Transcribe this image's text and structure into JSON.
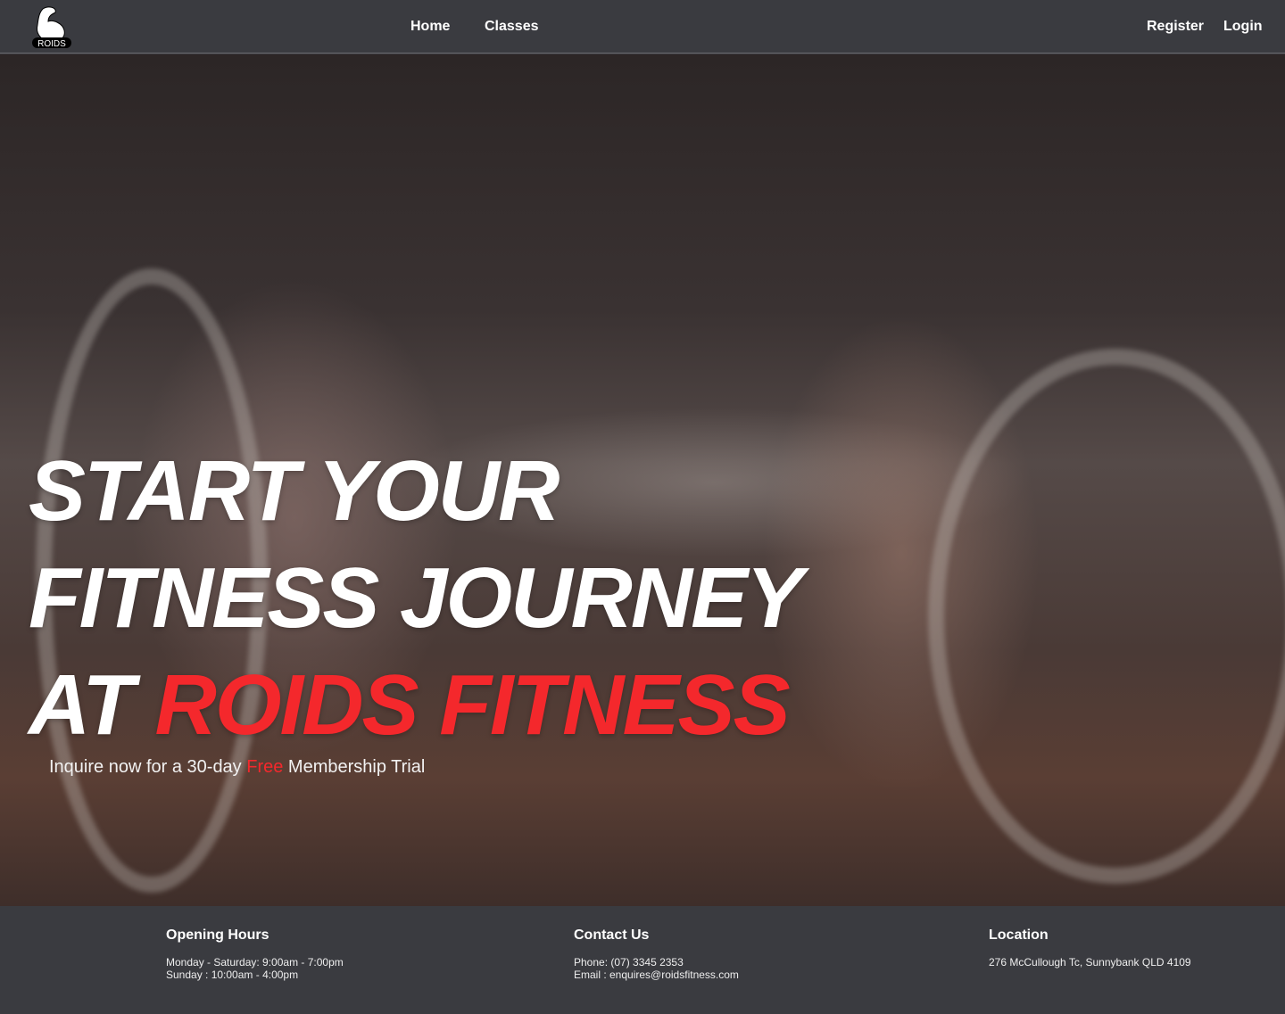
{
  "nav": {
    "logo_text": "ROIDS",
    "links": [
      {
        "label": "Home"
      },
      {
        "label": "Classes"
      }
    ],
    "auth": [
      {
        "label": "Register"
      },
      {
        "label": "Login"
      }
    ]
  },
  "hero": {
    "line1": "START YOUR",
    "line2": "FITNESS JOURNEY",
    "line3_prefix": "AT ",
    "line3_highlight": "ROIDS FITNESS",
    "sub_prefix": "Inquire now for a 30-day ",
    "sub_highlight": "Free",
    "sub_suffix": " Membership Trial",
    "accent_color": "#f4282c"
  },
  "footer": {
    "hours": {
      "title": "Opening Hours",
      "lines": [
        "Monday - Saturday: 9:00am - 7:00pm",
        "Sunday : 10:00am - 4:00pm"
      ]
    },
    "contact": {
      "title": "Contact Us",
      "lines": [
        "Phone: (07) 3345 2353",
        "Email : enquires@roidsfitness.com"
      ]
    },
    "location": {
      "title": "Location",
      "lines": [
        "276 McCullough Tc, Sunnybank QLD 4109"
      ]
    }
  }
}
